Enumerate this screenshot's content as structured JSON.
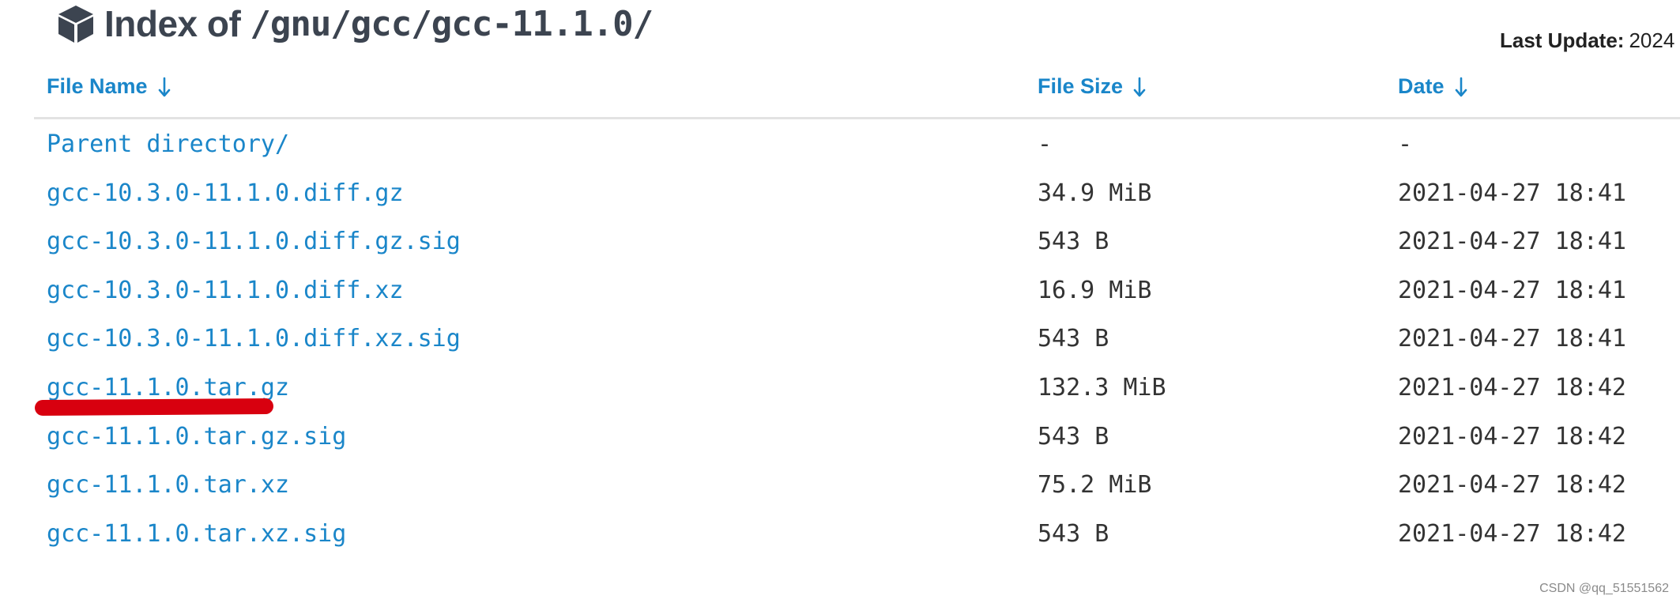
{
  "header": {
    "title_prefix": "Index of",
    "title_path": "/gnu/gcc/gcc-11.1.0/",
    "icon": "cube-icon"
  },
  "last_update": {
    "label": "Last Update:",
    "value": "2024"
  },
  "table": {
    "columns": [
      {
        "label": "File Name",
        "icon": "arrow-down-icon"
      },
      {
        "label": "File Size",
        "icon": "arrow-down-icon"
      },
      {
        "label": "Date",
        "icon": "arrow-down-icon"
      }
    ],
    "rows": [
      {
        "name": "Parent directory/",
        "size": "-",
        "date": "-"
      },
      {
        "name": "gcc-10.3.0-11.1.0.diff.gz",
        "size": "34.9 MiB",
        "date": "2021-04-27 18:41"
      },
      {
        "name": "gcc-10.3.0-11.1.0.diff.gz.sig",
        "size": "543 B",
        "date": "2021-04-27 18:41"
      },
      {
        "name": "gcc-10.3.0-11.1.0.diff.xz",
        "size": "16.9 MiB",
        "date": "2021-04-27 18:41"
      },
      {
        "name": "gcc-10.3.0-11.1.0.diff.xz.sig",
        "size": "543 B",
        "date": "2021-04-27 18:41"
      },
      {
        "name": "gcc-11.1.0.tar.gz",
        "size": "132.3 MiB",
        "date": "2021-04-27 18:42"
      },
      {
        "name": "gcc-11.1.0.tar.gz.sig",
        "size": "543 B",
        "date": "2021-04-27 18:42"
      },
      {
        "name": "gcc-11.1.0.tar.xz",
        "size": "75.2 MiB",
        "date": "2021-04-27 18:42"
      },
      {
        "name": "gcc-11.1.0.tar.xz.sig",
        "size": "543 B",
        "date": "2021-04-27 18:42"
      }
    ]
  },
  "annotation": {
    "highlighted_row": "gcc-11.1.0.tar.gz",
    "color": "#d8000f"
  },
  "watermark": "CSDN @qq_51551562",
  "colors": {
    "link": "#1a86c9",
    "title": "#3c4450",
    "text": "#333333"
  }
}
